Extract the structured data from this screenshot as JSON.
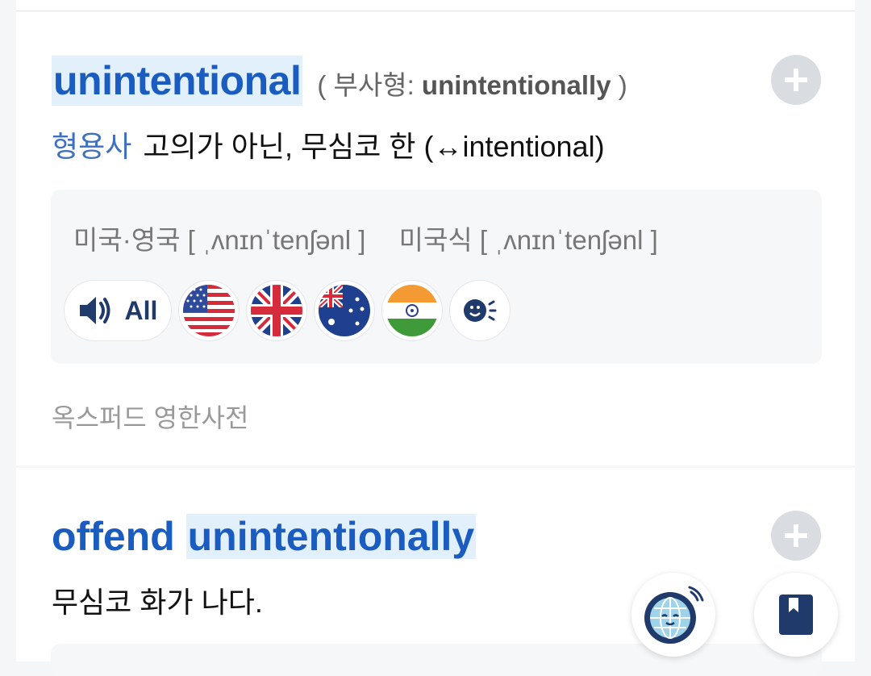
{
  "entry1": {
    "headword": "unintentional",
    "variant_prefix": "( 부사형: ",
    "variant_word": "unintentionally",
    "variant_suffix": " )",
    "part_of_speech": "형용사",
    "meaning": "고의가 아닌, 무심코 한 (↔intentional)",
    "pron1_label": "미국·영국",
    "pron1": "[ ˌʌnɪnˈtenʃənl ]",
    "pron2_label": "미국식",
    "pron2": "[ ˌʌnɪnˈtenʃənl ]",
    "audio_all_label": "All",
    "source": "옥스퍼드 영한사전"
  },
  "entry2": {
    "headword_plain": "offend ",
    "headword_highlight": "unintentionally",
    "meaning": "무심코 화가 나다."
  },
  "icons": [
    "plus-icon",
    "speaker-icon",
    "us-flag-icon",
    "uk-flag-icon",
    "au-flag-icon",
    "in-flag-icon",
    "voice-face-icon",
    "globe-character-icon",
    "bookmark-icon"
  ],
  "colors": {
    "accent": "#1a5cbf",
    "highlight": "#e1f0fb",
    "pos": "#3f6fbf"
  }
}
